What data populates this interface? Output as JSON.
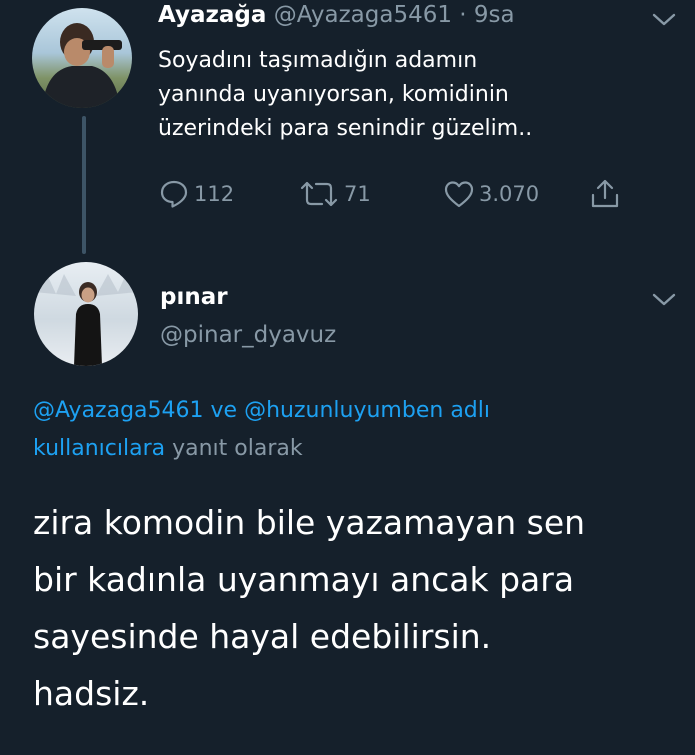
{
  "original_tweet": {
    "display_name": "Ayazağa",
    "handle": "@Ayazaga5461",
    "separator": "·",
    "time": "9sa",
    "text_lines": [
      "Soyadını taşımadığın adamın",
      "yanında uyanıyorsan, komidinin",
      "üzerindeki para senindir güzelim.."
    ],
    "reply_count": "112",
    "retweet_count": "71",
    "like_count": "3.070"
  },
  "reply_tweet": {
    "display_name": "pınar",
    "handle": "@pinar_dyavuz",
    "reply_to": {
      "mention1": "@Ayazaga5461",
      "connector": "ve",
      "mention2": "@huzunluyumben",
      "mention_suffix": "adlı",
      "mention_suffix2": "kullanıcılara",
      "trailing": "yanıt olarak"
    },
    "text_lines": [
      "zira komodin bile yazamayan sen",
      "bir kadınla uyanmayı ancak para",
      "sayesinde hayal edebilirsin.",
      "hadsiz."
    ]
  },
  "colors": {
    "background": "#15202b",
    "primary_text": "#ffffff",
    "secondary_text": "#8899a6",
    "link": "#1da1f2",
    "thread_line": "#3d5466"
  },
  "icons": {
    "reply": "reply-icon",
    "retweet": "retweet-icon",
    "like": "heart-icon",
    "share": "share-icon",
    "menu": "chevron-down-icon"
  }
}
